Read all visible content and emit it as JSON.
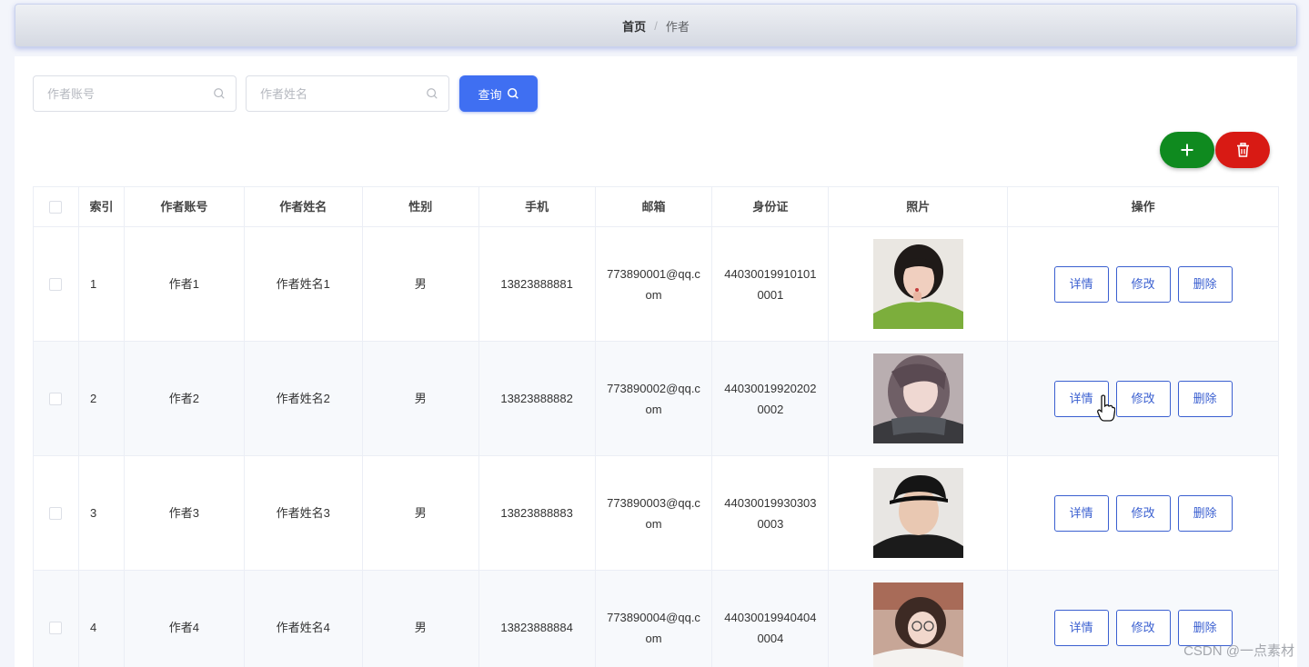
{
  "breadcrumb": {
    "home": "首页",
    "separator": "/",
    "current": "作者"
  },
  "search": {
    "account_placeholder": "作者账号",
    "name_placeholder": "作者姓名",
    "query_label": "查询"
  },
  "actions": {
    "add_icon": "plus-icon",
    "delete_icon": "trash-icon"
  },
  "table": {
    "headers": {
      "index": "索引",
      "account": "作者账号",
      "name": "作者姓名",
      "gender": "性别",
      "phone": "手机",
      "email": "邮箱",
      "id_card": "身份证",
      "photo": "照片",
      "ops": "操作"
    },
    "rows": [
      {
        "index": "1",
        "account": "作者1",
        "name": "作者姓名1",
        "gender": "男",
        "phone": "13823888881",
        "email": "773890001@qq.com",
        "id_card": "440300199101010001",
        "detail": "详情",
        "edit": "修改",
        "delete": "删除"
      },
      {
        "index": "2",
        "account": "作者2",
        "name": "作者姓名2",
        "gender": "男",
        "phone": "13823888882",
        "email": "773890002@qq.com",
        "id_card": "440300199202020002",
        "detail": "详情",
        "edit": "修改",
        "delete": "删除"
      },
      {
        "index": "3",
        "account": "作者3",
        "name": "作者姓名3",
        "gender": "男",
        "phone": "13823888883",
        "email": "773890003@qq.com",
        "id_card": "440300199303030003",
        "detail": "详情",
        "edit": "修改",
        "delete": "删除"
      },
      {
        "index": "4",
        "account": "作者4",
        "name": "作者姓名4",
        "gender": "男",
        "phone": "13823888884",
        "email": "773890004@qq.com",
        "id_card": "440300199404040004",
        "detail": "详情",
        "edit": "修改",
        "delete": "删除"
      }
    ]
  },
  "colors": {
    "primary": "#3f6ff2",
    "success": "#0f8a1f",
    "danger": "#d81a14",
    "link": "#3a5fd0"
  },
  "watermark": "CSDN @一点素材"
}
